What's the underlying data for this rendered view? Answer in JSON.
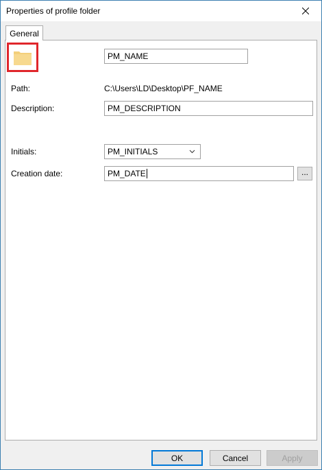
{
  "window": {
    "title": "Properties of profile folder",
    "close_glyph": "close-icon"
  },
  "tabs": [
    {
      "label": "General",
      "selected": true
    }
  ],
  "general": {
    "folder_icon": "folder-icon",
    "name_value": "PM_NAME",
    "path_label": "Path:",
    "path_value": "C:\\Users\\LD\\Desktop\\PF_NAME",
    "description_label": "Description:",
    "description_value": "PM_DESCRIPTION",
    "initials_label": "Initials:",
    "initials_value": "PM_INITIALS",
    "creation_date_label": "Creation date:",
    "creation_date_value": "PM_DATE",
    "browse_label": "..."
  },
  "buttons": {
    "ok": "OK",
    "cancel": "Cancel",
    "apply": "Apply"
  },
  "colors": {
    "highlight": "#e0262b",
    "folder": "#f3cf7b",
    "accent": "#0078d7"
  }
}
